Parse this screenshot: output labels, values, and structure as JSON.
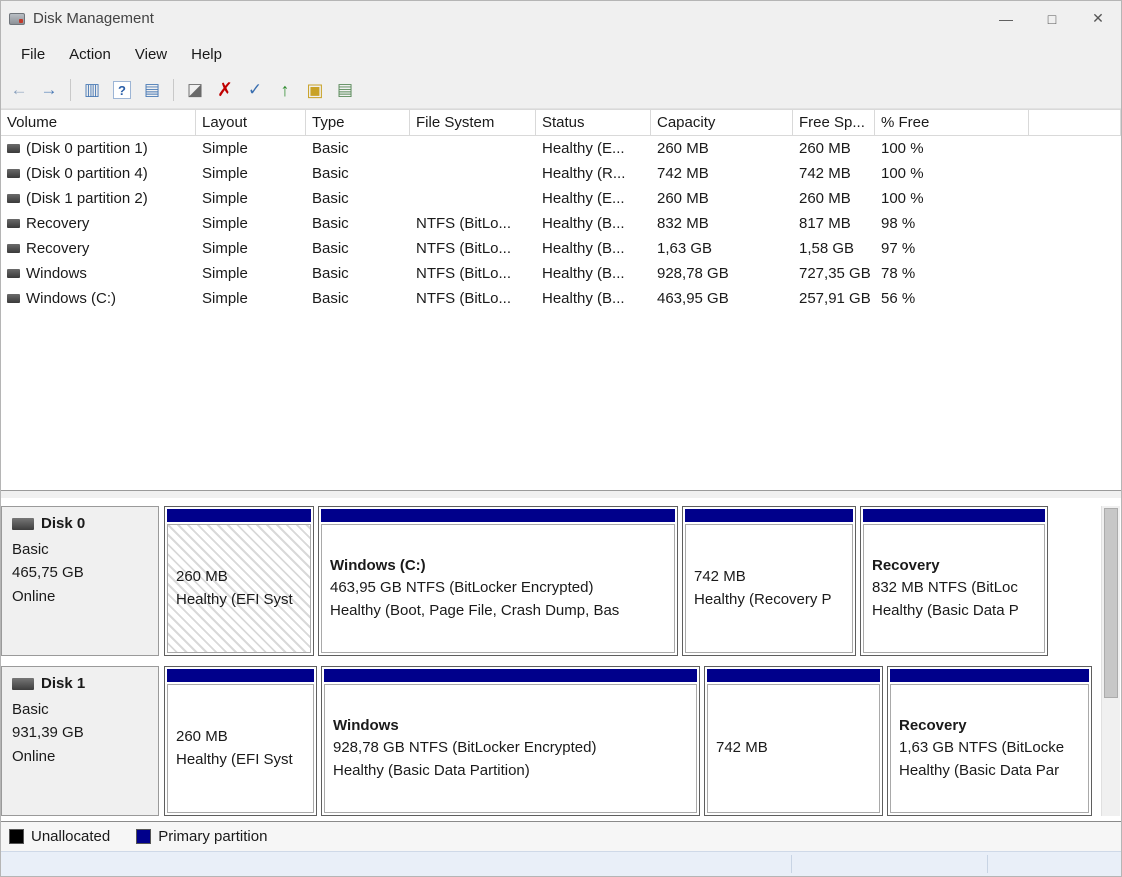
{
  "colors": {
    "primary_partition": "#00008b",
    "unallocated": "#000000"
  },
  "window": {
    "title": "Disk Management",
    "minimize": "—",
    "maximize": "□",
    "close": "✕"
  },
  "menu": {
    "items": [
      "File",
      "Action",
      "View",
      "Help"
    ]
  },
  "toolbar": {
    "back": "←",
    "forward": "→",
    "console_tree": "▥",
    "help": "?",
    "action_pane": "▤",
    "tool": "◪",
    "delete": "✗",
    "check": "✓",
    "up": "↑",
    "explore": "▣",
    "tasks": "▤"
  },
  "table": {
    "columns": [
      "Volume",
      "Layout",
      "Type",
      "File System",
      "Status",
      "Capacity",
      "Free Sp...",
      "% Free"
    ],
    "rows": [
      {
        "volume": "(Disk 0 partition 1)",
        "layout": "Simple",
        "type": "Basic",
        "fs": "",
        "status": "Healthy (E...",
        "capacity": "260 MB",
        "free": "260 MB",
        "pct": "100 %"
      },
      {
        "volume": "(Disk 0 partition 4)",
        "layout": "Simple",
        "type": "Basic",
        "fs": "",
        "status": "Healthy (R...",
        "capacity": "742 MB",
        "free": "742 MB",
        "pct": "100 %"
      },
      {
        "volume": "(Disk 1 partition 2)",
        "layout": "Simple",
        "type": "Basic",
        "fs": "",
        "status": "Healthy (E...",
        "capacity": "260 MB",
        "free": "260 MB",
        "pct": "100 %"
      },
      {
        "volume": "Recovery",
        "layout": "Simple",
        "type": "Basic",
        "fs": "NTFS (BitLo...",
        "status": "Healthy (B...",
        "capacity": "832 MB",
        "free": "817 MB",
        "pct": "98 %"
      },
      {
        "volume": "Recovery",
        "layout": "Simple",
        "type": "Basic",
        "fs": "NTFS (BitLo...",
        "status": "Healthy (B...",
        "capacity": "1,63 GB",
        "free": "1,58 GB",
        "pct": "97 %"
      },
      {
        "volume": "Windows",
        "layout": "Simple",
        "type": "Basic",
        "fs": "NTFS (BitLo...",
        "status": "Healthy (B...",
        "capacity": "928,78 GB",
        "free": "727,35 GB",
        "pct": "78 %"
      },
      {
        "volume": "Windows (C:)",
        "layout": "Simple",
        "type": "Basic",
        "fs": "NTFS (BitLo...",
        "status": "Healthy (B...",
        "capacity": "463,95 GB",
        "free": "257,91 GB",
        "pct": "56 %"
      }
    ]
  },
  "disks": [
    {
      "name": "Disk 0",
      "type": "Basic",
      "size": "465,75 GB",
      "status": "Online",
      "partitions": [
        {
          "title": "",
          "line1": "260 MB",
          "line2": "Healthy (EFI Syst"
        },
        {
          "title": "Windows  (C:)",
          "line1": "463,95 GB NTFS (BitLocker Encrypted)",
          "line2": "Healthy (Boot, Page File, Crash Dump, Bas"
        },
        {
          "title": "",
          "line1": "742 MB",
          "line2": "Healthy (Recovery P"
        },
        {
          "title": "Recovery",
          "line1": "832 MB NTFS (BitLoc",
          "line2": "Healthy (Basic Data P"
        }
      ]
    },
    {
      "name": "Disk 1",
      "type": "Basic",
      "size": "931,39 GB",
      "status": "Online",
      "partitions": [
        {
          "title": "",
          "line1": "260 MB",
          "line2": "Healthy (EFI Syst"
        },
        {
          "title": "Windows",
          "line1": "928,78 GB NTFS (BitLocker Encrypted)",
          "line2": "Healthy (Basic Data Partition)"
        },
        {
          "title": "",
          "line1": "742 MB",
          "line2": ""
        },
        {
          "title": "Recovery",
          "line1": "1,63 GB NTFS (BitLocke",
          "line2": "Healthy (Basic Data Par"
        }
      ]
    }
  ],
  "legend": {
    "unallocated": "Unallocated",
    "primary": "Primary partition"
  }
}
